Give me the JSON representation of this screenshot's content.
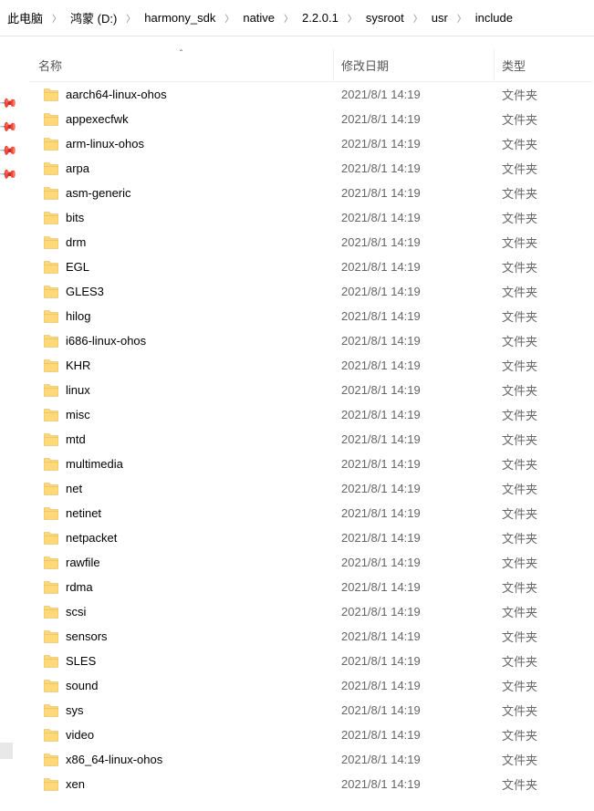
{
  "breadcrumb": [
    {
      "label": "此电脑"
    },
    {
      "label": "鸿蒙 (D:)"
    },
    {
      "label": "harmony_sdk"
    },
    {
      "label": "native"
    },
    {
      "label": "2.2.0.1"
    },
    {
      "label": "sysroot"
    },
    {
      "label": "usr"
    },
    {
      "label": "include"
    }
  ],
  "headers": {
    "name": "名称",
    "modified": "修改日期",
    "type": "类型"
  },
  "rows": [
    {
      "name": "aarch64-linux-ohos",
      "date": "2021/8/1 14:19",
      "type": "文件夹"
    },
    {
      "name": "appexecfwk",
      "date": "2021/8/1 14:19",
      "type": "文件夹"
    },
    {
      "name": "arm-linux-ohos",
      "date": "2021/8/1 14:19",
      "type": "文件夹"
    },
    {
      "name": "arpa",
      "date": "2021/8/1 14:19",
      "type": "文件夹"
    },
    {
      "name": "asm-generic",
      "date": "2021/8/1 14:19",
      "type": "文件夹"
    },
    {
      "name": "bits",
      "date": "2021/8/1 14:19",
      "type": "文件夹"
    },
    {
      "name": "drm",
      "date": "2021/8/1 14:19",
      "type": "文件夹"
    },
    {
      "name": "EGL",
      "date": "2021/8/1 14:19",
      "type": "文件夹"
    },
    {
      "name": "GLES3",
      "date": "2021/8/1 14:19",
      "type": "文件夹"
    },
    {
      "name": "hilog",
      "date": "2021/8/1 14:19",
      "type": "文件夹"
    },
    {
      "name": "i686-linux-ohos",
      "date": "2021/8/1 14:19",
      "type": "文件夹"
    },
    {
      "name": "KHR",
      "date": "2021/8/1 14:19",
      "type": "文件夹"
    },
    {
      "name": "linux",
      "date": "2021/8/1 14:19",
      "type": "文件夹"
    },
    {
      "name": "misc",
      "date": "2021/8/1 14:19",
      "type": "文件夹"
    },
    {
      "name": "mtd",
      "date": "2021/8/1 14:19",
      "type": "文件夹"
    },
    {
      "name": "multimedia",
      "date": "2021/8/1 14:19",
      "type": "文件夹"
    },
    {
      "name": "net",
      "date": "2021/8/1 14:19",
      "type": "文件夹"
    },
    {
      "name": "netinet",
      "date": "2021/8/1 14:19",
      "type": "文件夹"
    },
    {
      "name": "netpacket",
      "date": "2021/8/1 14:19",
      "type": "文件夹"
    },
    {
      "name": "rawfile",
      "date": "2021/8/1 14:19",
      "type": "文件夹"
    },
    {
      "name": "rdma",
      "date": "2021/8/1 14:19",
      "type": "文件夹"
    },
    {
      "name": "scsi",
      "date": "2021/8/1 14:19",
      "type": "文件夹"
    },
    {
      "name": "sensors",
      "date": "2021/8/1 14:19",
      "type": "文件夹"
    },
    {
      "name": "SLES",
      "date": "2021/8/1 14:19",
      "type": "文件夹"
    },
    {
      "name": "sound",
      "date": "2021/8/1 14:19",
      "type": "文件夹"
    },
    {
      "name": "sys",
      "date": "2021/8/1 14:19",
      "type": "文件夹"
    },
    {
      "name": "video",
      "date": "2021/8/1 14:19",
      "type": "文件夹"
    },
    {
      "name": "x86_64-linux-ohos",
      "date": "2021/8/1 14:19",
      "type": "文件夹"
    },
    {
      "name": "xen",
      "date": "2021/8/1 14:19",
      "type": "文件夹"
    }
  ]
}
